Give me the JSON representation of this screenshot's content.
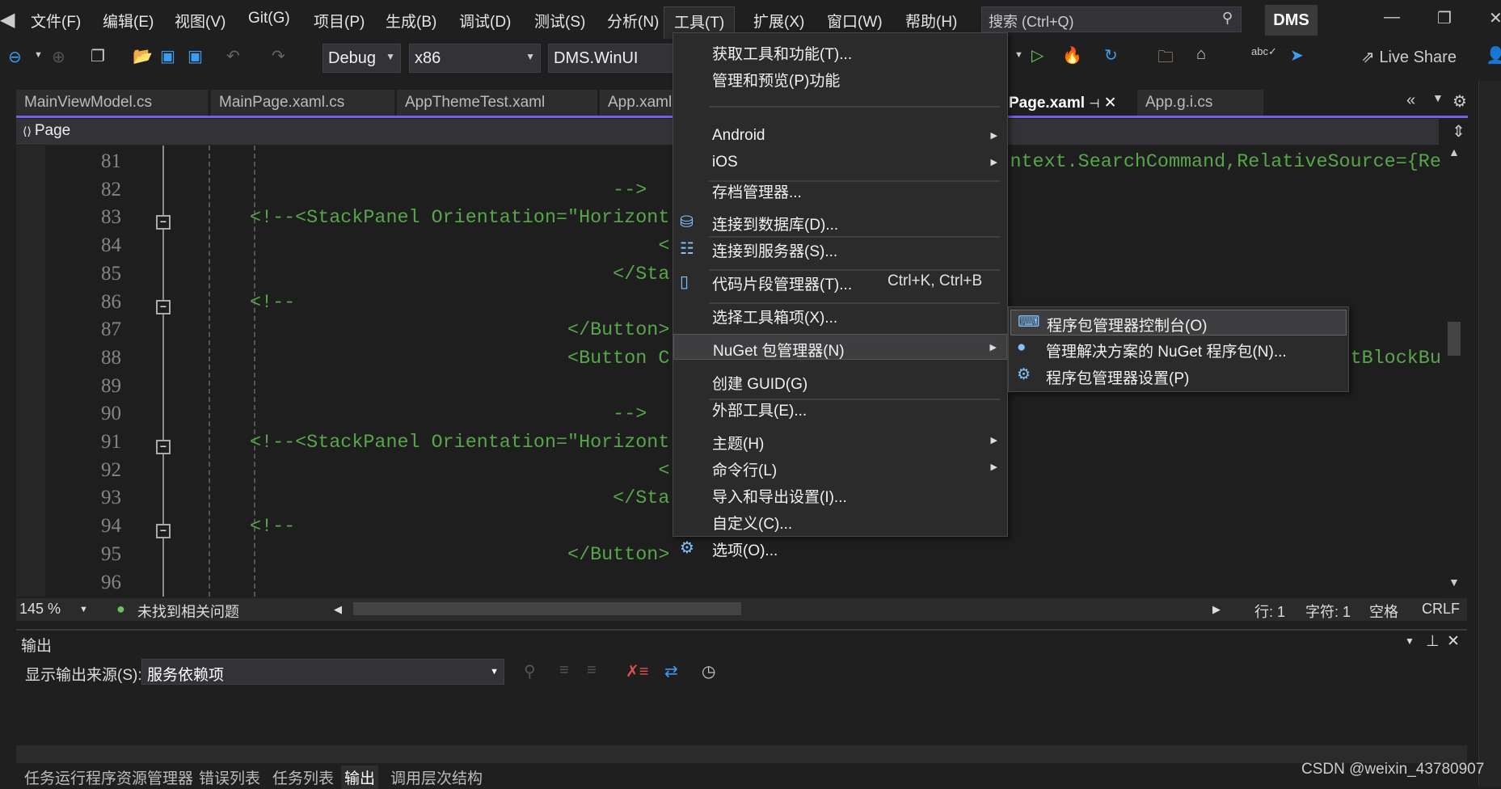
{
  "menubar": {
    "items": [
      "文件(F)",
      "编辑(E)",
      "视图(V)",
      "Git(G)",
      "项目(P)",
      "生成(B)",
      "调试(D)",
      "测试(S)",
      "分析(N)",
      "工具(T)",
      "扩展(X)",
      "窗口(W)",
      "帮助(H)"
    ],
    "search_placeholder": "搜索 (Ctrl+Q)",
    "solution_badge": "DMS"
  },
  "toolbar": {
    "config": "Debug",
    "platform": "x86",
    "startup_project": "DMS.WinUI",
    "live_share": "Live Share"
  },
  "tabs": [
    {
      "label": "MainViewModel.cs"
    },
    {
      "label": "MainPage.xaml.cs"
    },
    {
      "label": "AppThemeTest.xaml"
    },
    {
      "label": "App.xaml"
    },
    {
      "label": "Page.xaml",
      "active": true
    },
    {
      "label": "App.g.i.cs"
    }
  ],
  "navbar": {
    "scope": "Page"
  },
  "editor": {
    "lines": [
      {
        "n": "81",
        "t": "                                                                   ntext.SearchCommand,RelativeSource={Rel"
      },
      {
        "n": "82",
        "t": "                                -->"
      },
      {
        "n": "83",
        "t": "<!--<StackPanel Orientation=\"Horizont",
        "fold": true
      },
      {
        "n": "84",
        "t": "                                    <"
      },
      {
        "n": "85",
        "t": "                                </Sta"
      },
      {
        "n": "86",
        "t": "<!--",
        "fold": true
      },
      {
        "n": "87",
        "t": "                            </Button>"
      },
      {
        "n": "88",
        "t": "                            <Button C                                                            tBlockBut"
      },
      {
        "n": "89",
        "t": ""
      },
      {
        "n": "90",
        "t": "                                -->"
      },
      {
        "n": "91",
        "t": "<!--<StackPanel Orientation=\"Horizont",
        "fold": true
      },
      {
        "n": "92",
        "t": "                                    <"
      },
      {
        "n": "93",
        "t": "                                </Sta"
      },
      {
        "n": "94",
        "t": "<!--",
        "fold": true
      },
      {
        "n": "95",
        "t": "                            </Button>"
      },
      {
        "n": "96",
        "t": ""
      }
    ]
  },
  "status": {
    "zoom": "145 %",
    "issues": "未找到相关问题",
    "line": "行: 1",
    "char": "字符: 1",
    "whitespace": "空格",
    "eol": "CRLF"
  },
  "output": {
    "title": "输出",
    "source_label": "显示输出来源(S):",
    "source_value": "服务依赖项"
  },
  "bottom_tabs": [
    {
      "label": "任务运行程序资源管理器"
    },
    {
      "label": "错误列表"
    },
    {
      "label": "任务列表"
    },
    {
      "label": "输出",
      "active": true
    },
    {
      "label": "调用层次结构"
    }
  ],
  "tools_menu": {
    "items": [
      {
        "label": "获取工具和功能(T)..."
      },
      {
        "label": "管理和预览(P)功能"
      },
      {
        "label": "Android",
        "submenu": true
      },
      {
        "label": "iOS",
        "submenu": true
      },
      {
        "label": "存档管理器..."
      },
      {
        "label": "连接到数据库(D)...",
        "icon": "database-connect-icon"
      },
      {
        "label": "连接到服务器(S)...",
        "icon": "server-connect-icon"
      },
      {
        "label": "代码片段管理器(T)...",
        "shortcut": "Ctrl+K, Ctrl+B",
        "icon": "snippet-icon"
      },
      {
        "label": "选择工具箱项(X)..."
      },
      {
        "label": "NuGet 包管理器(N)",
        "submenu": true,
        "highlighted": true
      },
      {
        "label": "创建 GUID(G)"
      },
      {
        "label": "外部工具(E)..."
      },
      {
        "label": "主题(H)",
        "submenu": true
      },
      {
        "label": "命令行(L)",
        "submenu": true
      },
      {
        "label": "导入和导出设置(I)..."
      },
      {
        "label": "自定义(C)..."
      },
      {
        "label": "选项(O)...",
        "icon": "gear-icon"
      }
    ]
  },
  "nuget_submenu": {
    "items": [
      {
        "label": "程序包管理器控制台(O)",
        "icon": "console-icon",
        "highlighted": true
      },
      {
        "label": "管理解决方案的 NuGet 程序包(N)...",
        "icon": "nuget-icon"
      },
      {
        "label": "程序包管理器设置(P)",
        "icon": "gear-icon"
      }
    ]
  },
  "watermark": "CSDN @weixin_43780907",
  "colors": {
    "accent": "#7160e8",
    "code_comment": "#57a64a",
    "background": "#1e1e1e"
  }
}
